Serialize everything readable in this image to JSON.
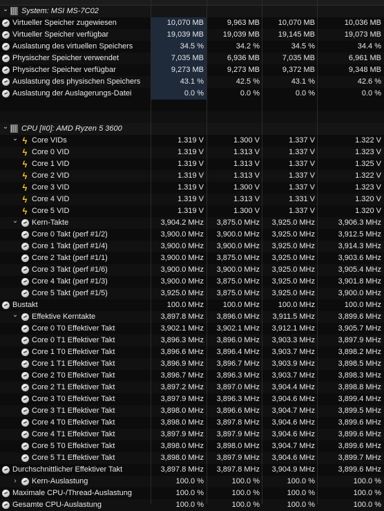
{
  "system_group": {
    "title": "System: MSI MS-7C02"
  },
  "system_rows": [
    {
      "label": "Virtueller Speicher zugewiesen",
      "cur": "10,070 MB",
      "min": "9,963 MB",
      "max": "10,070 MB",
      "avg": "10,036 MB"
    },
    {
      "label": "Virtueller Speicher verfügbar",
      "cur": "19,039 MB",
      "min": "19,039 MB",
      "max": "19,145 MB",
      "avg": "19,073 MB"
    },
    {
      "label": "Auslastung des virtuellen Speichers",
      "cur": "34.5 %",
      "min": "34.2 %",
      "max": "34.5 %",
      "avg": "34.4 %"
    },
    {
      "label": "Physischer Speicher verwendet",
      "cur": "7,035 MB",
      "min": "6,936 MB",
      "max": "7,035 MB",
      "avg": "6,961 MB"
    },
    {
      "label": "Physischer Speicher verfügbar",
      "cur": "9,273 MB",
      "min": "9,273 MB",
      "max": "9,372 MB",
      "avg": "9,348 MB"
    },
    {
      "label": "Auslastung des physischen Speichers",
      "cur": "43.1 %",
      "min": "42.5 %",
      "max": "43.1 %",
      "avg": "42.6 %"
    },
    {
      "label": "Auslastung der Auslagerungs-Datei",
      "cur": "0.0 %",
      "min": "0.0 %",
      "max": "0.0 %",
      "avg": "0.0 %"
    }
  ],
  "cpu_group": {
    "title": "CPU [#0]: AMD Ryzen 5 3600"
  },
  "cpu_rows": [
    {
      "label": "Core VIDs",
      "cur": "1.319 V",
      "min": "1.300 V",
      "max": "1.337 V",
      "avg": "1.322 V",
      "icon": "bolt-icon",
      "level": 1,
      "chev": "v"
    },
    {
      "label": "Core 0 VID",
      "cur": "1.319 V",
      "min": "1.313 V",
      "max": "1.337 V",
      "avg": "1.323 V",
      "icon": "bolt-icon",
      "level": 2
    },
    {
      "label": "Core 1 VID",
      "cur": "1.319 V",
      "min": "1.313 V",
      "max": "1.337 V",
      "avg": "1.325 V",
      "icon": "bolt-icon",
      "level": 2
    },
    {
      "label": "Core 2 VID",
      "cur": "1.319 V",
      "min": "1.313 V",
      "max": "1.337 V",
      "avg": "1.322 V",
      "icon": "bolt-icon",
      "level": 2
    },
    {
      "label": "Core 3 VID",
      "cur": "1.319 V",
      "min": "1.300 V",
      "max": "1.337 V",
      "avg": "1.323 V",
      "icon": "bolt-icon",
      "level": 2
    },
    {
      "label": "Core 4 VID",
      "cur": "1.319 V",
      "min": "1.313 V",
      "max": "1.331 V",
      "avg": "1.320 V",
      "icon": "bolt-icon",
      "level": 2
    },
    {
      "label": "Core 5 VID",
      "cur": "1.319 V",
      "min": "1.300 V",
      "max": "1.337 V",
      "avg": "1.320 V",
      "icon": "bolt-icon",
      "level": 2
    },
    {
      "label": "Kern-Takte",
      "cur": "3,904.2 MHz",
      "min": "3,875.0 MHz",
      "max": "3,925.0 MHz",
      "avg": "3,906.3 MHz",
      "icon": "sensor-icon",
      "level": 1,
      "chev": "v"
    },
    {
      "label": "Core 0 Takt (perf #1/2)",
      "cur": "3,900.0 MHz",
      "min": "3,900.0 MHz",
      "max": "3,925.0 MHz",
      "avg": "3,912.5 MHz",
      "icon": "sensor-icon",
      "level": 2
    },
    {
      "label": "Core 1 Takt (perf #1/4)",
      "cur": "3,900.0 MHz",
      "min": "3,900.0 MHz",
      "max": "3,925.0 MHz",
      "avg": "3,914.3 MHz",
      "icon": "sensor-icon",
      "level": 2
    },
    {
      "label": "Core 2 Takt (perf #1/1)",
      "cur": "3,900.0 MHz",
      "min": "3,875.0 MHz",
      "max": "3,925.0 MHz",
      "avg": "3,903.6 MHz",
      "icon": "sensor-icon",
      "level": 2
    },
    {
      "label": "Core 3 Takt (perf #1/6)",
      "cur": "3,900.0 MHz",
      "min": "3,900.0 MHz",
      "max": "3,925.0 MHz",
      "avg": "3,905.4 MHz",
      "icon": "sensor-icon",
      "level": 2
    },
    {
      "label": "Core 4 Takt (perf #1/3)",
      "cur": "3,900.0 MHz",
      "min": "3,875.0 MHz",
      "max": "3,925.0 MHz",
      "avg": "3,901.8 MHz",
      "icon": "sensor-icon",
      "level": 2
    },
    {
      "label": "Core 5 Takt (perf #1/5)",
      "cur": "3,925.0 MHz",
      "min": "3,875.0 MHz",
      "max": "3,925.0 MHz",
      "avg": "3,900.0 MHz",
      "icon": "sensor-icon",
      "level": 2
    },
    {
      "label": "Bustakt",
      "cur": "100.0 MHz",
      "min": "100.0 MHz",
      "max": "100.0 MHz",
      "avg": "100.0 MHz",
      "icon": "sensor-icon",
      "level": 0
    },
    {
      "label": "Effektive Kerntakte",
      "cur": "3,897.8 MHz",
      "min": "3,896.0 MHz",
      "max": "3,911.5 MHz",
      "avg": "3,899.6 MHz",
      "icon": "sensor-icon",
      "level": 1,
      "chev": "v"
    },
    {
      "label": "Core 0 T0 Effektiver Takt",
      "cur": "3,902.1 MHz",
      "min": "3,902.1 MHz",
      "max": "3,912.1 MHz",
      "avg": "3,905.7 MHz",
      "icon": "sensor-icon",
      "level": 2
    },
    {
      "label": "Core 0 T1 Effektiver Takt",
      "cur": "3,896.3 MHz",
      "min": "3,896.0 MHz",
      "max": "3,903.3 MHz",
      "avg": "3,897.9 MHz",
      "icon": "sensor-icon",
      "level": 2
    },
    {
      "label": "Core 1 T0 Effektiver Takt",
      "cur": "3,896.6 MHz",
      "min": "3,896.4 MHz",
      "max": "3,903.7 MHz",
      "avg": "3,898.2 MHz",
      "icon": "sensor-icon",
      "level": 2
    },
    {
      "label": "Core 1 T1 Effektiver Takt",
      "cur": "3,896.9 MHz",
      "min": "3,896.7 MHz",
      "max": "3,903.9 MHz",
      "avg": "3,898.5 MHz",
      "icon": "sensor-icon",
      "level": 2
    },
    {
      "label": "Core 2 T0 Effektiver Takt",
      "cur": "3,896.7 MHz",
      "min": "3,896.3 MHz",
      "max": "3,903.7 MHz",
      "avg": "3,898.3 MHz",
      "icon": "sensor-icon",
      "level": 2
    },
    {
      "label": "Core 2 T1 Effektiver Takt",
      "cur": "3,897.2 MHz",
      "min": "3,897.0 MHz",
      "max": "3,904.4 MHz",
      "avg": "3,898.8 MHz",
      "icon": "sensor-icon",
      "level": 2
    },
    {
      "label": "Core 3 T0 Effektiver Takt",
      "cur": "3,897.9 MHz",
      "min": "3,896.3 MHz",
      "max": "3,904.6 MHz",
      "avg": "3,899.4 MHz",
      "icon": "sensor-icon",
      "level": 2
    },
    {
      "label": "Core 3 T1 Effektiver Takt",
      "cur": "3,898.0 MHz",
      "min": "3,896.6 MHz",
      "max": "3,904.7 MHz",
      "avg": "3,899.5 MHz",
      "icon": "sensor-icon",
      "level": 2
    },
    {
      "label": "Core 4 T0 Effektiver Takt",
      "cur": "3,898.0 MHz",
      "min": "3,897.8 MHz",
      "max": "3,904.6 MHz",
      "avg": "3,899.6 MHz",
      "icon": "sensor-icon",
      "level": 2
    },
    {
      "label": "Core 4 T1 Effektiver Takt",
      "cur": "3,897.9 MHz",
      "min": "3,897.9 MHz",
      "max": "3,904.6 MHz",
      "avg": "3,899.6 MHz",
      "icon": "sensor-icon",
      "level": 2
    },
    {
      "label": "Core 5 T0 Effektiver Takt",
      "cur": "3,898.0 MHz",
      "min": "3,898.0 MHz",
      "max": "3,904.7 MHz",
      "avg": "3,899.6 MHz",
      "icon": "sensor-icon",
      "level": 2
    },
    {
      "label": "Core 5 T1 Effektiver Takt",
      "cur": "3,898.0 MHz",
      "min": "3,897.9 MHz",
      "max": "3,904.6 MHz",
      "avg": "3,899.7 MHz",
      "icon": "sensor-icon",
      "level": 2
    },
    {
      "label": "Durchschnittlicher Effektiver Takt",
      "cur": "3,897.8 MHz",
      "min": "3,897.8 MHz",
      "max": "3,904.9 MHz",
      "avg": "3,899.6 MHz",
      "icon": "sensor-icon",
      "level": 0
    },
    {
      "label": "Kern-Auslastung",
      "cur": "100.0 %",
      "min": "100.0 %",
      "max": "100.0 %",
      "avg": "100.0 %",
      "icon": "sensor-icon",
      "level": 1,
      "chev": ">"
    },
    {
      "label": "Maximale CPU-/Thread-Auslastung",
      "cur": "100.0 %",
      "min": "100.0 %",
      "max": "100.0 %",
      "avg": "100.0 %",
      "icon": "sensor-icon",
      "level": 0
    },
    {
      "label": "Gesamte CPU-Auslastung",
      "cur": "100.0 %",
      "min": "100.0 %",
      "max": "100.0 %",
      "avg": "100.0 %",
      "icon": "sensor-icon",
      "level": 0
    }
  ],
  "colors": {
    "background": "#0c0c0c",
    "highlight": "#1f2a3a",
    "bolt": "#f2c230"
  }
}
